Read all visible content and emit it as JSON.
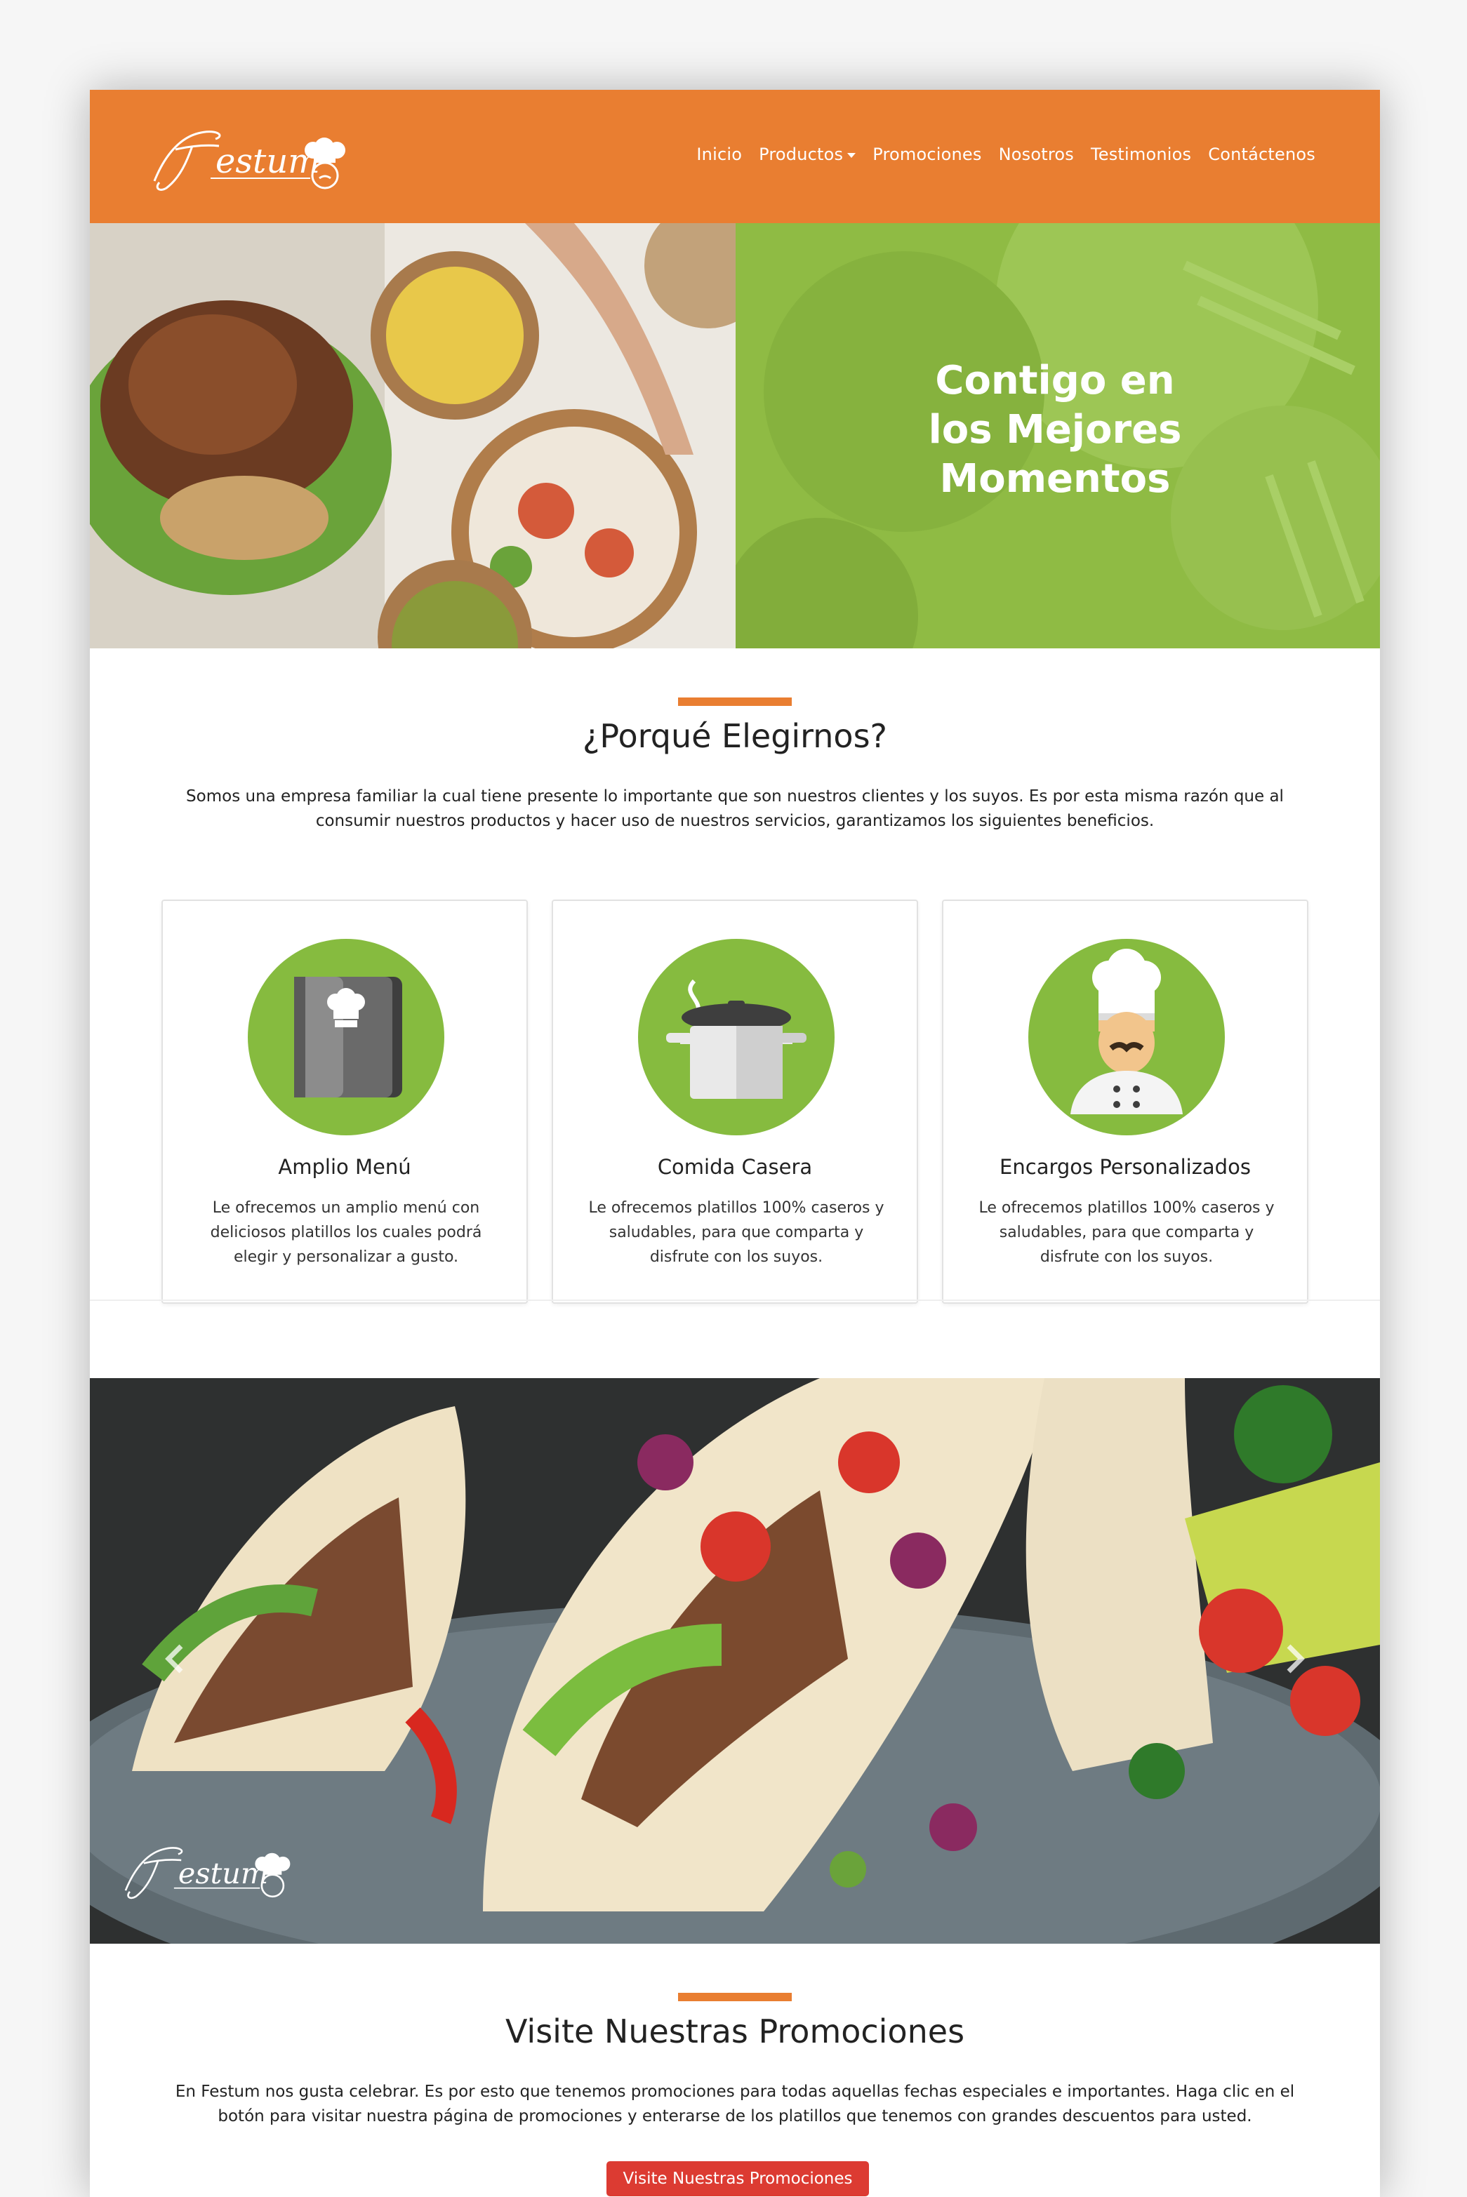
{
  "brand": {
    "name": "Festum"
  },
  "colors": {
    "accent": "#e97e31",
    "green": "#8fbb44",
    "button": "#dc3b32"
  },
  "nav": {
    "items": [
      {
        "label": "Inicio"
      },
      {
        "label": "Productos",
        "dropdown": true
      },
      {
        "label": "Promociones"
      },
      {
        "label": "Nosotros"
      },
      {
        "label": "Testimonios"
      },
      {
        "label": "Contáctenos"
      }
    ]
  },
  "hero": {
    "line1": "Contigo en",
    "line2": "los Mejores",
    "line3": "Momentos"
  },
  "why": {
    "title": "¿Porqué Elegirnos?",
    "line1": "Somos una empresa familiar la cual tiene presente lo importante que son nuestros clientes y los suyos. Es por esta misma razón que al",
    "line2": "consumir nuestros productos y hacer uso de nuestros servicios, garantizamos los siguientes beneficios."
  },
  "cards": [
    {
      "icon": "menu-book-icon",
      "title": "Amplio Menú",
      "lines": [
        "Le ofrecemos un amplio menú con",
        "deliciosos platillos los cuales podrá",
        "elegir y personalizar a gusto."
      ]
    },
    {
      "icon": "cooking-pot-icon",
      "title": "Comida Casera",
      "lines": [
        "Le ofrecemos platillos 100% caseros y",
        "saludables, para que comparta y",
        "disfrute con los suyos."
      ]
    },
    {
      "icon": "chef-icon",
      "title": "Encargos Personalizados",
      "lines": [
        "Le ofrecemos platillos 100% caseros y",
        "saludables, para que comparta y",
        "disfrute con los suyos."
      ]
    }
  ],
  "carousel": {
    "prev_icon": "chevron-left-icon",
    "next_icon": "chevron-right-icon"
  },
  "promo": {
    "title": "Visite Nuestras Promociones",
    "line1": "En Festum nos gusta celebrar. Es por esto que tenemos promociones para todas aquellas fechas especiales e importantes. Haga clic en el",
    "line2": "botón para visitar nuestra página de promociones y enterarse de los platillos que tenemos con grandes descuentos para usted.",
    "button_label": "Visite Nuestras Promociones"
  }
}
